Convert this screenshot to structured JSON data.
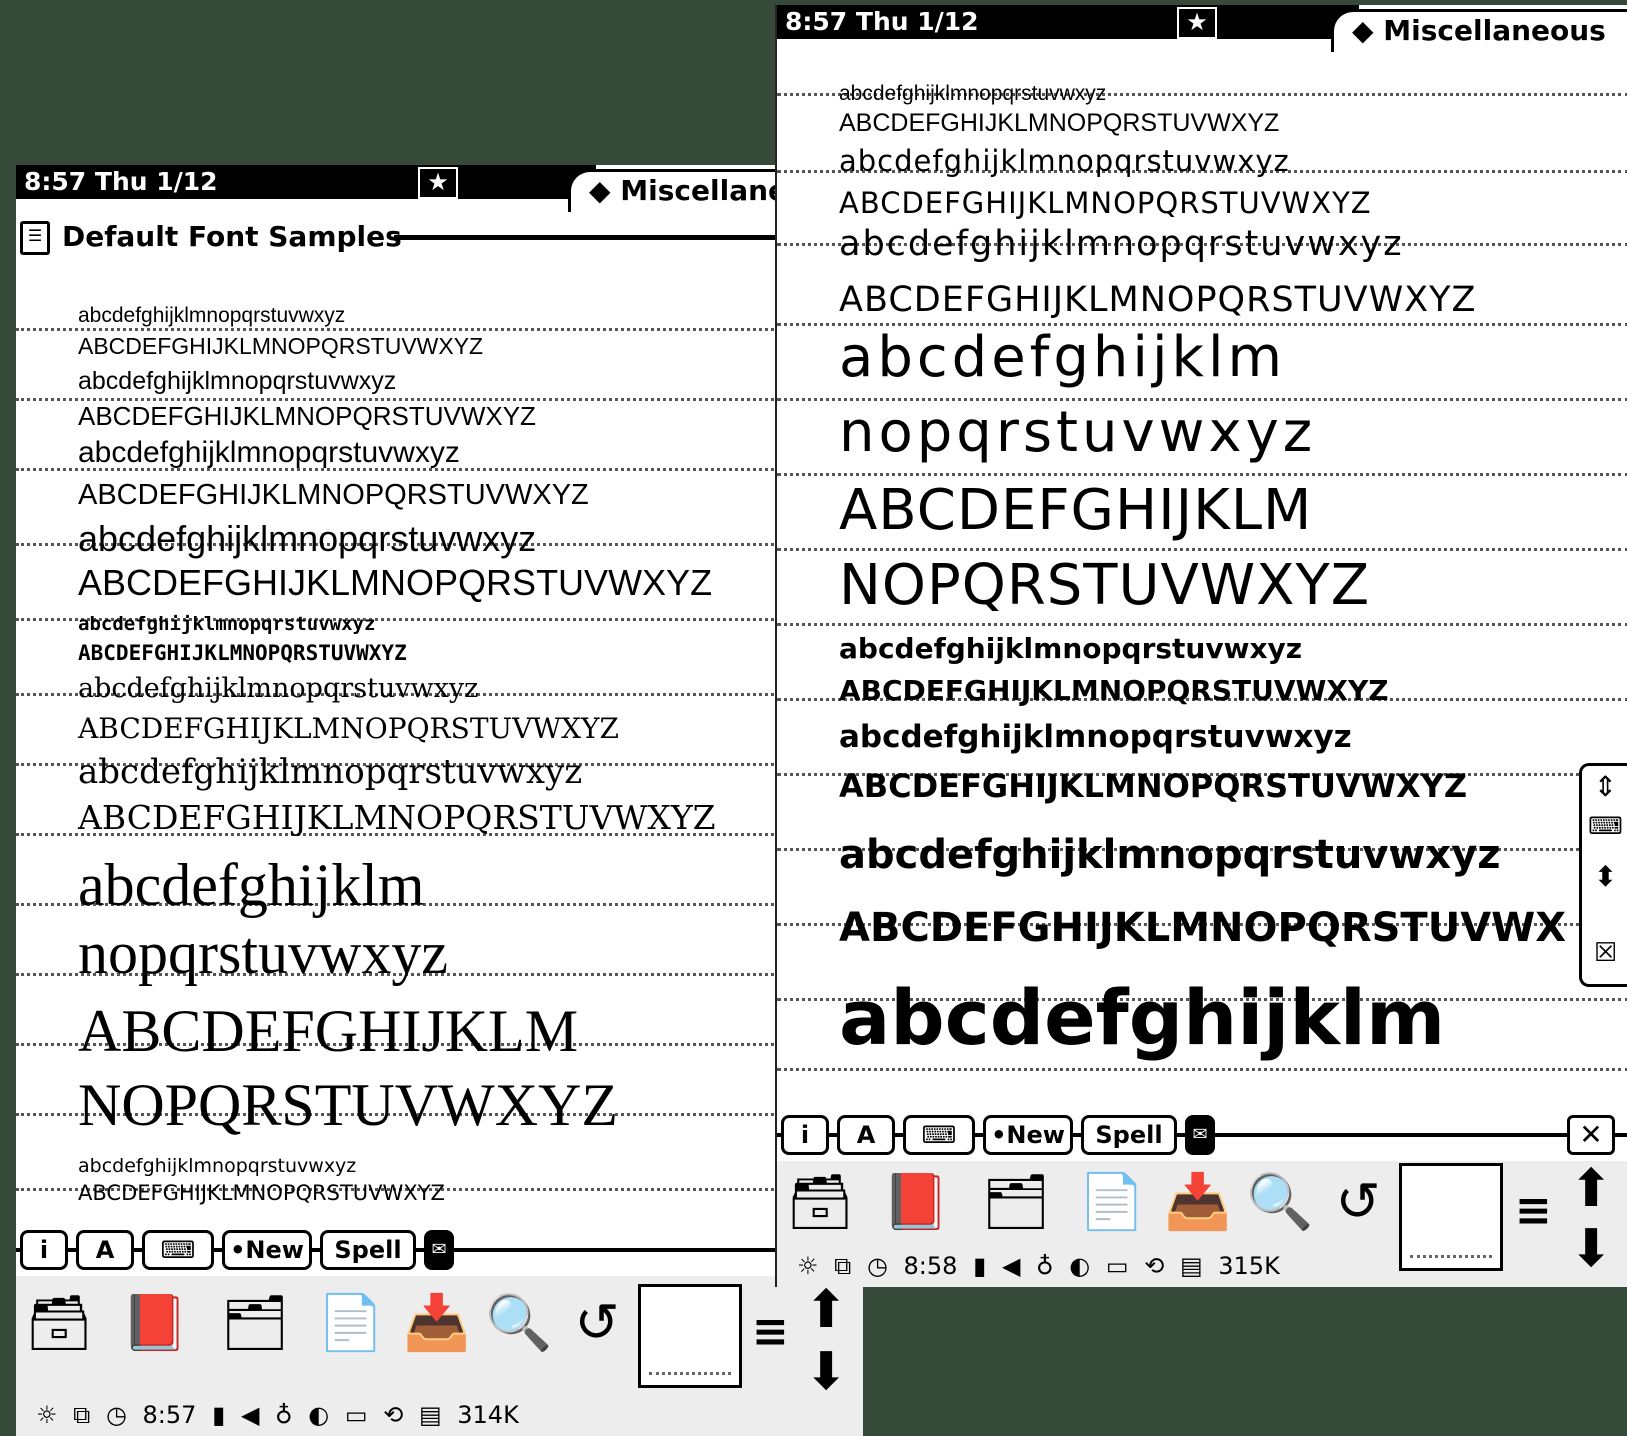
{
  "left": {
    "status_time": "8:57 Thu 1/12",
    "folder_tab": "◆ Miscellaneous",
    "note_title": "Default Font Samples",
    "samples": [
      "abcdefghijklmnopqrstuvwxyz",
      "ABCDEFGHIJKLMNOPQRSTUVWXYZ",
      "abcdefghijklmnopqrstuvwxyz",
      "ABCDEFGHIJKLMNOPQRSTUVWXYZ",
      "abcdefghijklmnopqrstuvwxyz",
      "ABCDEFGHIJKLMNOPQRSTUVWXYZ",
      "abcdefghijklmnopqrstuvwxyz",
      "ABCDEFGHIJKLMNOPQRSTUVWXYZ",
      "abcdefghijklmnopqrstuvwxyz",
      "ABCDEFGHIJKLMNOPQRSTUVWXYZ",
      "abcdefghijklmnopqrstuvwxyz",
      "ABCDEFGHIJKLMNOPQRSTUVWXYZ",
      "abcdefghijklmnopqrstuvwxyz",
      "ABCDEFGHIJKLMNOPQRSTUVWXYZ",
      "abcdefghijklm",
      "nopqrstuvwxyz",
      "ABCDEFGHIJKLM",
      "NOPQRSTUVWXYZ",
      "abcdefghijklmnopqrstuvwxyz",
      "ABCDEFGHIJKLMNOPQRSTUVWXYZ"
    ],
    "toolbar": {
      "info": "i",
      "style": "A",
      "keyboard": "⌨",
      "new": "•New",
      "spell": "Spell",
      "close": "✕"
    },
    "clock": "8:57",
    "memory": "314K"
  },
  "right": {
    "status_time": "8:57 Thu 1/12",
    "folder_tab": "◆ Miscellaneous",
    "samples": [
      "abcdefghijklmnopqrstuvwxyz",
      "ABCDEFGHIJKLMNOPQRSTUVWXYZ",
      "abcdefghijklmnopqrstuvwxyz",
      "ABCDEFGHIJKLMNOPQRSTUVWXYZ",
      "abcdefghijklmnopqrstuvwxyz",
      "ABCDEFGHIJKLMNOPQRSTUVWXYZ",
      "abcdefghijklm",
      "nopqrstuvwxyz",
      "ABCDEFGHIJKLM",
      "NOPQRSTUVWXYZ",
      "abcdefghijklmnopqrstuvwxyz",
      "ABCDEFGHIJKLMNOPQRSTUVWXYZ",
      "abcdefghijklmnopqrstuvwxyz",
      "ABCDEFGHIJKLMNOPQRSTUVWXYZ",
      "abcdefghijklmnopqrstuvwxyz",
      "ABCDEFGHIJKLMNOPQRSTUVWX",
      "abcdefghijklm"
    ],
    "toolbar": {
      "info": "i",
      "style": "A",
      "keyboard": "⌨",
      "new": "•New",
      "spell": "Spell",
      "close": "✕"
    },
    "clock": "8:58",
    "memory": "315K"
  },
  "icons": {
    "extras": "drawer-icon",
    "dates": "dates-book-icon",
    "names": "names-cards-icon",
    "notes": "notepad-icon",
    "inout": "in-out-box-icon",
    "find": "find-magnifier-icon",
    "undo": "undo-icon",
    "scroll_up": "scroll-up-icon",
    "scroll_down": "scroll-down-icon"
  }
}
